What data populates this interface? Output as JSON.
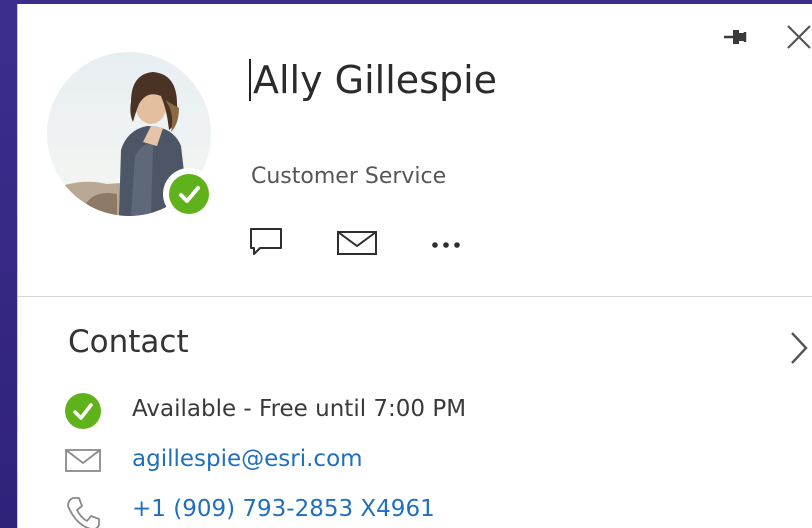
{
  "contact_card": {
    "name": "Ally Gillespie",
    "department": "Customer Service",
    "presence": "available",
    "header_actions": [
      "pin-icon",
      "close-icon"
    ],
    "quick_actions": [
      "chat-icon",
      "mail-icon",
      "more-icon"
    ]
  },
  "contact_section": {
    "title": "Contact",
    "status": "Available - Free until 7:00 PM",
    "email": "agillespie@esri.com",
    "phone": "+1 (909) 793-2853 X4961"
  },
  "colors": {
    "accent_purple": "#3a2d8c",
    "presence_green": "#5fb21a",
    "link_blue": "#1f6fbf"
  }
}
